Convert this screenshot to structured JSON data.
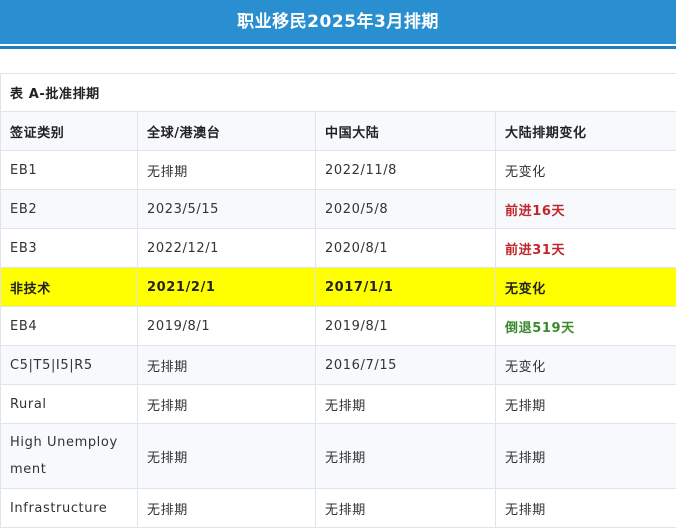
{
  "page": {
    "title": "职业移民2025年3月排期"
  },
  "colors": {
    "banner": "#2a8fd0",
    "highlight": "#ffff00",
    "advance_red": "#c0272d",
    "retrogress_green": "#3b8a2e"
  },
  "table": {
    "caption": "表 A-批准排期",
    "headers": [
      "签证类别",
      "全球/港澳台",
      "中国大陆",
      "大陆排期变化"
    ],
    "rows": [
      {
        "category": "EB1",
        "global": "无排期",
        "china": "2022/11/8",
        "change": "无变化",
        "change_style": "normal"
      },
      {
        "category": "EB2",
        "global": "2023/5/15",
        "china": "2020/5/8",
        "change": "前进16天",
        "change_style": "advance"
      },
      {
        "category": "EB3",
        "global": "2022/12/1",
        "china": "2020/8/1",
        "change": "前进31天",
        "change_style": "advance"
      },
      {
        "category": "非技术",
        "global": "2021/2/1",
        "china": "2017/1/1",
        "change": "无变化",
        "change_style": "highlight"
      },
      {
        "category": "EB4",
        "global": "2019/8/1",
        "china": "2019/8/1",
        "change": "倒退519天",
        "change_style": "retrogress"
      },
      {
        "category": "C5|T5|I5|R5",
        "global": "无排期",
        "china": "2016/7/15",
        "change": "无变化",
        "change_style": "normal"
      },
      {
        "category": "Rural",
        "global": "无排期",
        "china": "无排期",
        "change": "无排期",
        "change_style": "normal"
      },
      {
        "category": " High Unemployment",
        "global": "无排期",
        "china": "无排期",
        "change": "无排期",
        "change_style": "normal"
      },
      {
        "category": "Infrastructure",
        "global": "无排期",
        "china": "无排期",
        "change": "无排期",
        "change_style": "normal"
      }
    ]
  }
}
